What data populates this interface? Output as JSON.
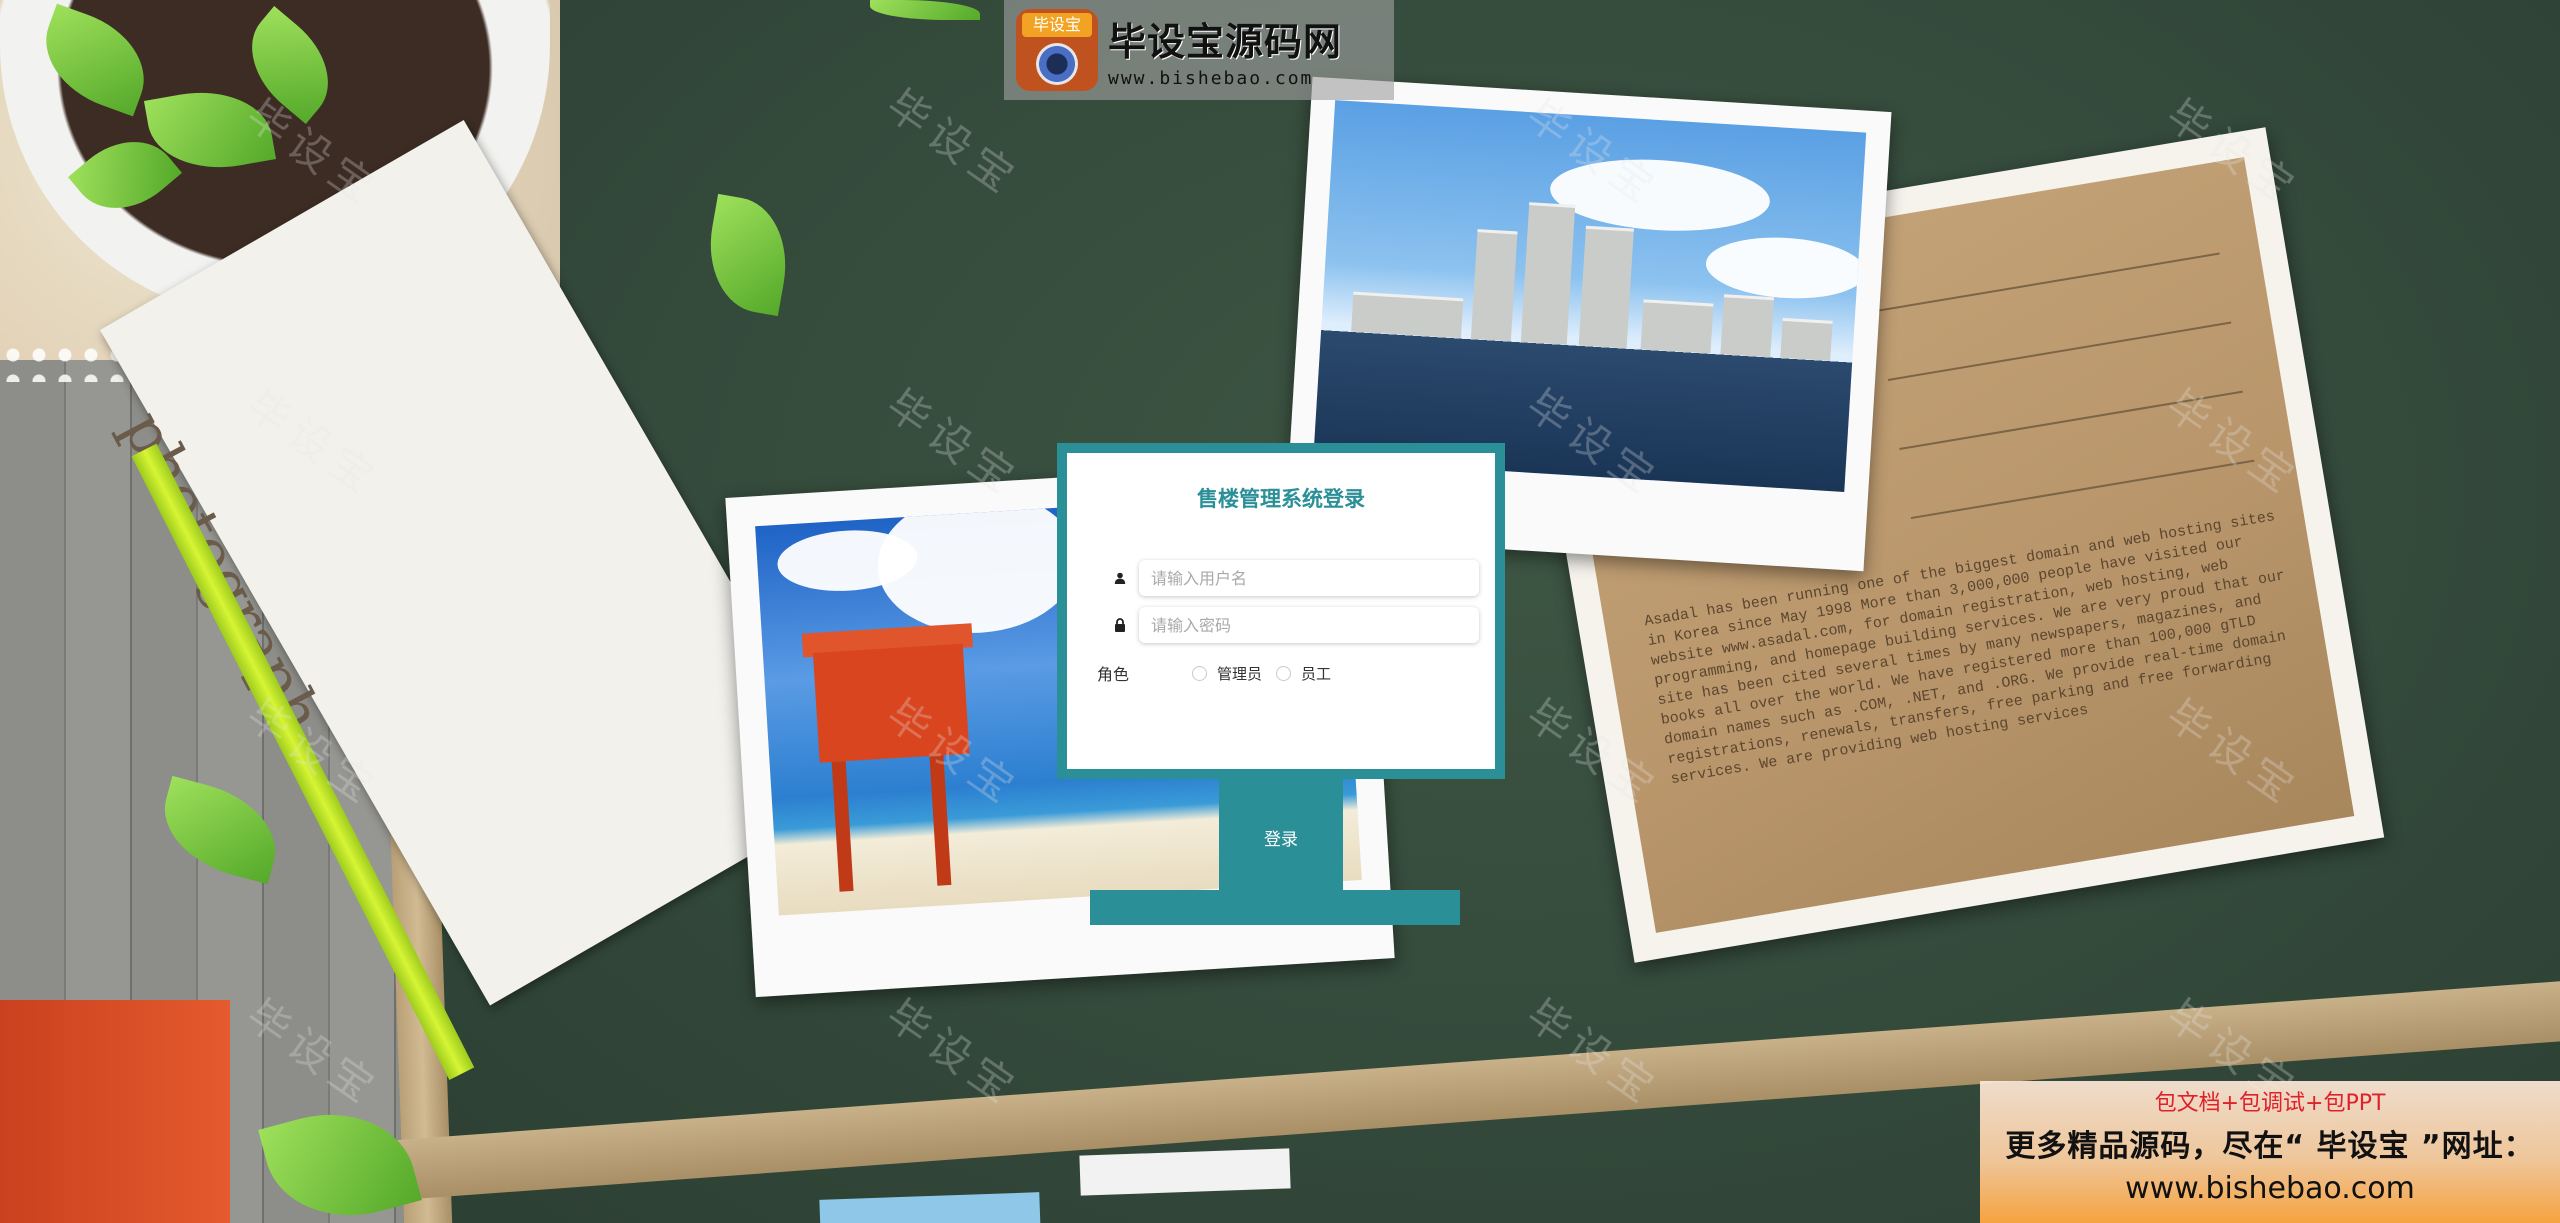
{
  "site_logo": {
    "badge": "毕设宝",
    "title": "毕设宝源码网",
    "url": "www.bishebao.com"
  },
  "watermark": "毕设宝",
  "decor": {
    "paper_word": "photograph",
    "postcard_text": "Asadal has been running one of the biggest domain and web hosting sites in Korea since May 1998 More than 3,000,000 people have visited our website www.asadal.com, for domain registration, web hosting, web programming, and homepage building services. We are very proud that our site has been cited several times by many newspapers, magazines, and books all over the world. We have registered more than 100,000 gTLD domain names such as .COM, .NET, and .ORG. We provide real-time domain registrations, renewals, transfers, free parking and free forwarding services. We are providing web hosting services"
  },
  "login": {
    "title": "售楼管理系统登录",
    "username": {
      "value": "",
      "placeholder": "请输入用户名",
      "icon": "user-icon"
    },
    "password": {
      "value": "",
      "placeholder": "请输入密码",
      "icon": "lock-icon"
    },
    "role_label": "角色",
    "roles": [
      {
        "label": "管理员",
        "checked": false
      },
      {
        "label": "员工",
        "checked": false
      }
    ],
    "submit_label": "登录"
  },
  "promo": {
    "line1": "包文档+包调试+包PPT",
    "line2": "更多精品源码，尽在“ 毕设宝 ”网址：",
    "line3": "www.bishebao.com"
  },
  "colors": {
    "accent": "#2b8f98",
    "chalkboard": "#344a3b",
    "promo_red": "#e0202b"
  }
}
